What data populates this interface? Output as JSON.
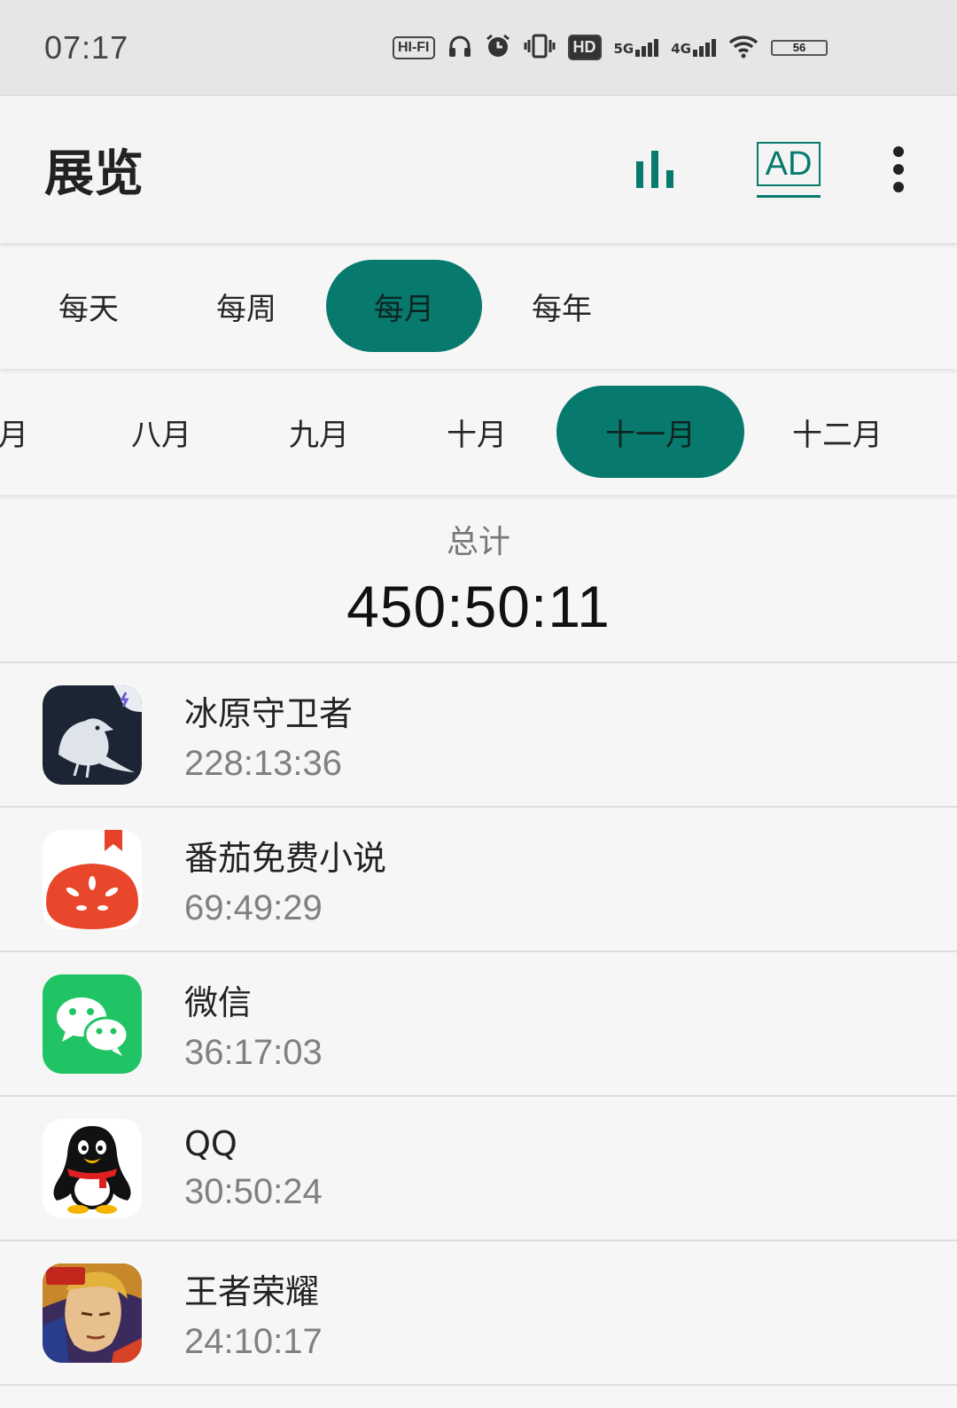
{
  "status_bar": {
    "time": "07:17",
    "hifi_label": "HI-FI",
    "hd_label": "HD",
    "net1_label": "5G",
    "net2_label": "4G",
    "battery_label": "56",
    "icons": [
      "hifi-icon",
      "headphones-icon",
      "alarm-icon",
      "vibrate-icon",
      "hd-volte-icon",
      "signal-5g-icon",
      "signal-4g-icon",
      "wifi-icon",
      "battery-icon"
    ]
  },
  "app_bar": {
    "title": "展览",
    "ad_label": "AD",
    "accent": "#077a6d"
  },
  "period_tabs": [
    {
      "label": "每天",
      "active": false
    },
    {
      "label": "每周",
      "active": false
    },
    {
      "label": "每月",
      "active": true
    },
    {
      "label": "每年",
      "active": false
    }
  ],
  "month_tabs": [
    {
      "label": "七月",
      "active": false
    },
    {
      "label": "八月",
      "active": false
    },
    {
      "label": "九月",
      "active": false
    },
    {
      "label": "十月",
      "active": false
    },
    {
      "label": "十一月",
      "active": true
    },
    {
      "label": "十二月",
      "active": false
    }
  ],
  "summary": {
    "label": "总计",
    "value": "450:50:11"
  },
  "apps": [
    {
      "name": "冰原守卫者",
      "time": "228:13:36",
      "icon": "raven-game-icon"
    },
    {
      "name": "番茄免费小说",
      "time": "69:49:29",
      "icon": "tomato-novel-icon"
    },
    {
      "name": "微信",
      "time": "36:17:03",
      "icon": "wechat-icon"
    },
    {
      "name": "QQ",
      "time": "30:50:24",
      "icon": "qq-penguin-icon"
    },
    {
      "name": "王者荣耀",
      "time": "24:10:17",
      "icon": "honor-of-kings-icon"
    }
  ]
}
